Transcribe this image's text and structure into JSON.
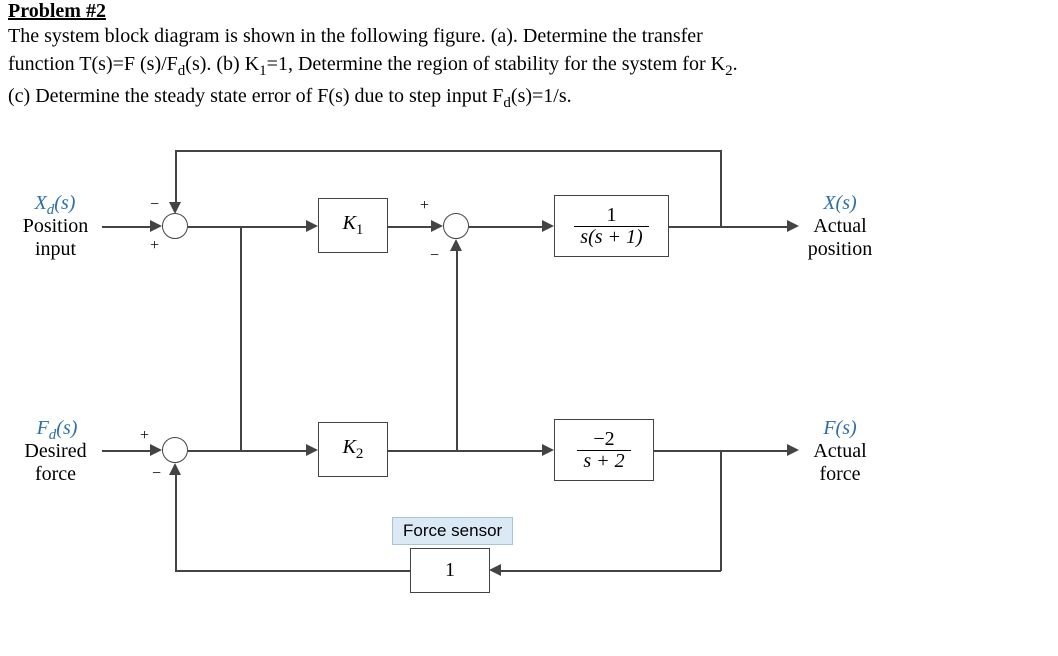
{
  "heading": "Problem #2",
  "text_line1": "The system block diagram is shown in the following figure. (a). Determine the transfer",
  "text_line2_a": "function T(s)=F (s)/F",
  "text_line2_sub": "d",
  "text_line2_b": "(s). (b) K",
  "text_line2_sub2": "1",
  "text_line2_c": "=1, Determine the region of stability for the system for K",
  "text_line2_sub3": "2",
  "text_line2_d": ".",
  "text_line3_a": "(c) Determine the steady state error of F(s) due to step input F",
  "text_line3_sub": "d",
  "text_line3_b": "(s)=1/s.",
  "labels": {
    "Xd_s": "X",
    "Xd_sub": "d",
    "Xd_rest": "(s)",
    "pos_input_l1": "Position",
    "pos_input_l2": "input",
    "X_s": "X(s)",
    "actual_pos_l1": "Actual",
    "actual_pos_l2": "position",
    "Fd_s": "F",
    "Fd_sub": "d",
    "Fd_rest": "(s)",
    "desired_force_l1": "Desired",
    "desired_force_l2": "force",
    "F_s": "F(s)",
    "actual_force_l1": "Actual",
    "actual_force_l2": "force"
  },
  "blocks": {
    "K1": "K",
    "K1_sub": "1",
    "K2": "K",
    "K2_sub": "2",
    "plant_num": "1",
    "plant_den_a": "s(s + 1)",
    "force_tf_num": "−2",
    "force_tf_den": "s + 2",
    "sensor": "1",
    "force_sensor_label": "Force sensor"
  },
  "signs": {
    "plus": "+",
    "minus": "−"
  }
}
